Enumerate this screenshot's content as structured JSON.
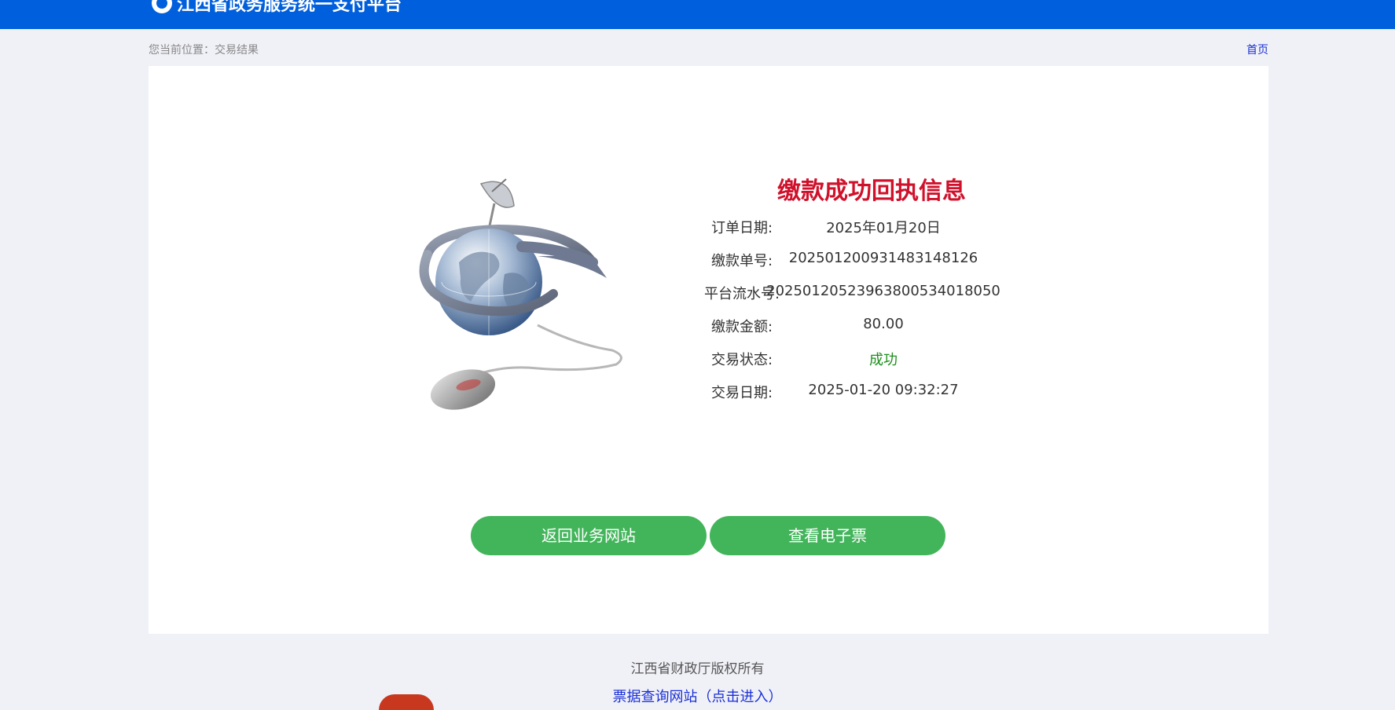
{
  "header": {
    "logo_text": "江西省政务服务统一支付平台"
  },
  "breadcrumb": {
    "text": "您当前位置：交易结果"
  },
  "nav": {
    "home": "首页"
  },
  "receipt": {
    "title": "缴款成功回执信息",
    "rows": [
      {
        "label": "订单日期:",
        "value": "2025年01月20日"
      },
      {
        "label": "缴款单号:",
        "value": "20250120093148314812­6"
      },
      {
        "label": "平台流水号:",
        "value": "202501205239638005340180­50"
      },
      {
        "label": "缴款金额:",
        "value": "80.00"
      },
      {
        "label": "交易状态:",
        "value": "成功"
      },
      {
        "label": "交易日期:",
        "value": "2025-01-20 09:32:27"
      }
    ]
  },
  "buttons": {
    "back": "返回业务网站",
    "view_invoice": "查看电子票"
  },
  "footer": {
    "copyright": "江西省财政厅版权所有",
    "query_link": "票据查询网站（点击进入）"
  },
  "colors": {
    "header_bg": "#005fdc",
    "title_red": "#d0112b",
    "button_green": "#42b55b",
    "status_green": "#1a8f1a"
  }
}
